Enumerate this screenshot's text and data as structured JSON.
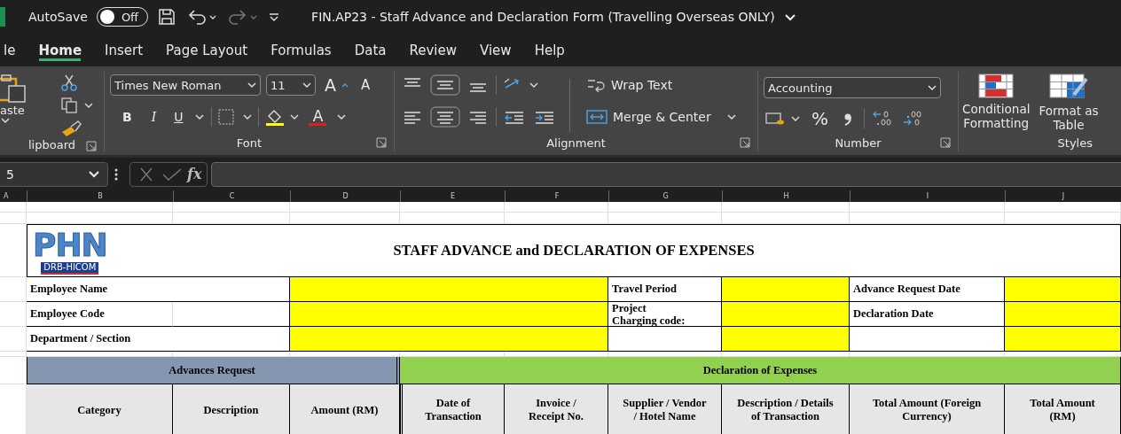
{
  "title_bar": {
    "autosave_label": "AutoSave",
    "autosave": {
      "on": false,
      "label": "Off"
    },
    "document_title": "FIN.AP23 - Staff Advance and Declaration Form (Travelling Overseas ONLY)"
  },
  "tabs": [
    {
      "label": "le",
      "selected": false
    },
    {
      "label": "Home",
      "selected": true
    },
    {
      "label": "Insert",
      "selected": false
    },
    {
      "label": "Page Layout",
      "selected": false
    },
    {
      "label": "Formulas",
      "selected": false
    },
    {
      "label": "Data",
      "selected": false
    },
    {
      "label": "Review",
      "selected": false
    },
    {
      "label": "View",
      "selected": false
    },
    {
      "label": "Help",
      "selected": false
    }
  ],
  "ribbon": {
    "clipboard": {
      "paste_label": "aste",
      "group_label": "lipboard"
    },
    "font": {
      "font_name": "Times New Roman",
      "font_size": "11",
      "grow": "A",
      "shrink": "A",
      "bold": "B",
      "italic": "I",
      "underline": "U",
      "font_color_label": "A",
      "group_label": "Font"
    },
    "alignment": {
      "wrap_text": "Wrap Text",
      "merge_center": "Merge & Center",
      "group_label": "Alignment"
    },
    "number": {
      "format": "Accounting",
      "percent": "%",
      "group_label": "Number"
    },
    "styles": {
      "conditional_formatting": [
        "Conditional",
        "Formatting"
      ],
      "format_as_table": [
        "Format as",
        "Table"
      ],
      "group_label": "Styles"
    }
  },
  "formula_bar": {
    "name_box": "5",
    "function_label": "fx"
  },
  "columns": [
    "A",
    "B",
    "C",
    "D",
    "E",
    "F",
    "G",
    "H",
    "I",
    "J"
  ],
  "sheet": {
    "logo": {
      "name": "PHN",
      "subtitle": "DRB-HICOM"
    },
    "form_title": "STAFF ADVANCE and DECLARATION OF EXPENSES",
    "details": {
      "employee_name": "Employee Name",
      "employee_code": "Employee Code",
      "department": "Department / Section",
      "travel_period": "Travel Period",
      "project_code": [
        "Project",
        "Charging code:"
      ],
      "advance_request_date": "Advance Request Date",
      "declaration_date": "Declaration Date"
    },
    "sections": [
      {
        "label": "Advances Request",
        "color": "#8496b0"
      },
      {
        "label": "Declaration of Expenses",
        "color": "#92d050"
      }
    ],
    "headers": [
      "Category",
      "Description",
      "Amount (RM)",
      "Date of Transaction",
      "Invoice / Receipt No.",
      "Supplier / Vendor / Hotel Name",
      "Description / Details of Transaction",
      "Total Amount (Foreign Currency)",
      "Total Amount (RM)"
    ]
  }
}
